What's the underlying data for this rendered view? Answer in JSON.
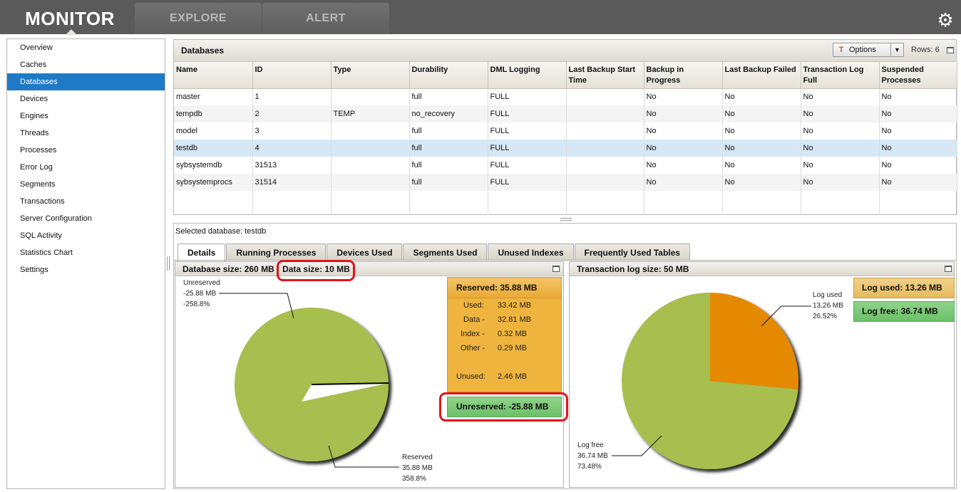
{
  "topbar": {
    "tabs": [
      "MONITOR",
      "EXPLORE",
      "ALERT"
    ],
    "settings_icon": "gear-icon"
  },
  "sidebar": {
    "items": [
      {
        "label": "Overview"
      },
      {
        "label": "Caches"
      },
      {
        "label": "Databases",
        "active": true
      },
      {
        "label": "Devices"
      },
      {
        "label": "Engines"
      },
      {
        "label": "Threads"
      },
      {
        "label": "Processes"
      },
      {
        "label": "Error Log"
      },
      {
        "label": "Segments"
      },
      {
        "label": "Transactions"
      },
      {
        "label": "Server Configuration"
      },
      {
        "label": "SQL Activity"
      },
      {
        "label": "Statistics Chart"
      },
      {
        "label": "Settings"
      }
    ]
  },
  "databases": {
    "title": "Databases",
    "options_label": "Options",
    "rows_label": "Rows: 6",
    "columns": [
      "Name",
      "ID",
      "Type",
      "Durability",
      "DML Logging",
      "Last Backup Start Time",
      "Backup in Progress",
      "Last Backup Failed",
      "Transaction Log Full",
      "Suspended Processes"
    ],
    "rows": [
      [
        "master",
        "1",
        "",
        "full",
        "FULL",
        "",
        "No",
        "No",
        "No",
        "No"
      ],
      [
        "tempdb",
        "2",
        "TEMP",
        "no_recovery",
        "FULL",
        "",
        "No",
        "No",
        "No",
        "No"
      ],
      [
        "model",
        "3",
        "",
        "full",
        "FULL",
        "",
        "No",
        "No",
        "No",
        "No"
      ],
      [
        "testdb",
        "4",
        "",
        "full",
        "FULL",
        "",
        "No",
        "No",
        "No",
        "No"
      ],
      [
        "sybsystemdb",
        "31513",
        "",
        "full",
        "FULL",
        "",
        "No",
        "No",
        "No",
        "No"
      ],
      [
        "sybsystemprocs",
        "31514",
        "",
        "full",
        "FULL",
        "",
        "No",
        "No",
        "No",
        "No"
      ]
    ],
    "selected_row": 3
  },
  "detail": {
    "selected_text": "Selected database: testdb",
    "tabs": [
      "Details",
      "Running Processes",
      "Devices Used",
      "Segments Used",
      "Unused Indexes",
      "Frequently Used Tables"
    ],
    "active_tab": 0
  },
  "dbsize": {
    "header": "Database size: 260 MB",
    "data_size": "Data size: 10 MB",
    "unreserved_callout": [
      "Unreserved",
      "-25.88 MB",
      "-258.8%"
    ],
    "reserved_callout": [
      "Reserved",
      "35.88 MB",
      "358.8%"
    ],
    "reserved_box": {
      "title": "Reserved: 35.88 MB",
      "rows": [
        {
          "label": "Used:",
          "value": "33.42 MB"
        },
        {
          "label": "Data -",
          "value": "32.81 MB"
        },
        {
          "label": "Index -",
          "value": "0.32 MB"
        },
        {
          "label": "Other -",
          "value": "0.29 MB"
        },
        {
          "label": "Unused:",
          "value": "2.46 MB"
        }
      ]
    },
    "unreserved_box": "Unreserved: -25.88 MB",
    "colors": {
      "reserved": "#a8be50",
      "reserved_box": "#efb43e",
      "unreserved_box": "#7ccb78",
      "highlight": "#e0141c"
    }
  },
  "txlog": {
    "header": "Transaction log size: 50 MB",
    "log_used_callout": [
      "Log used",
      "13.26 MB",
      "26.52%"
    ],
    "log_free_callout": [
      "Log free",
      "36.74 MB",
      "73.48%"
    ],
    "log_used_box": "Log used: 13.26 MB",
    "log_free_box": "Log free: 36.74 MB",
    "colors": {
      "used": "#e58a00",
      "free": "#a8be50"
    }
  },
  "chart_data": [
    {
      "type": "pie",
      "title": "Data size: 10 MB",
      "categories": [
        "Reserved",
        "Unreserved"
      ],
      "values": [
        35.88,
        -25.88
      ],
      "percentages": [
        358.8,
        -258.8
      ],
      "unit": "MB"
    },
    {
      "type": "pie",
      "title": "Transaction log size: 50 MB",
      "categories": [
        "Log used",
        "Log free"
      ],
      "values": [
        13.26,
        36.74
      ],
      "percentages": [
        26.52,
        73.48
      ],
      "unit": "MB"
    }
  ]
}
